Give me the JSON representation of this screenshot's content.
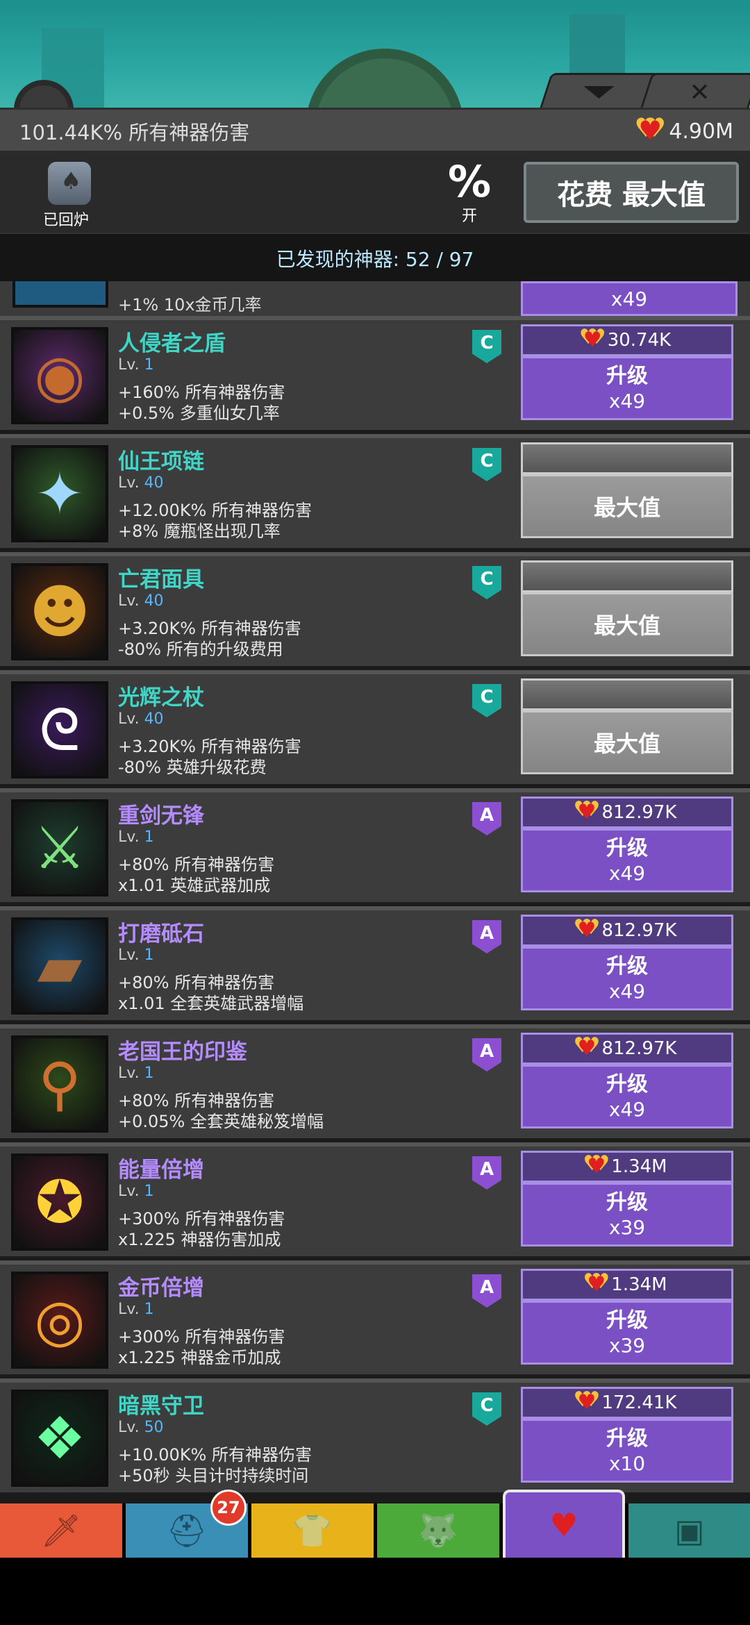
{
  "header": {
    "total_damage": "101.44K% 所有神器伤害",
    "relic_amount": "4.90M"
  },
  "controls": {
    "furnace_label": "已回炉",
    "percent_symbol": "%",
    "percent_state": "开",
    "max_button": "花费 最大值"
  },
  "discovered": "已发现的神器: 52 / 97",
  "partial_row": {
    "effect": "+1% 10x金币几率",
    "button": "x49"
  },
  "artifacts": [
    {
      "name": "人侵者之盾",
      "rarity": "C",
      "level_prefix": "Lv.",
      "level": "1",
      "effect1": "+160% 所有神器伤害",
      "effect2": "+0.5% 多重仙女几率",
      "cost": "30.74K",
      "action": "升级",
      "mult": "x49",
      "maxed": false,
      "icon": "shield-icon",
      "glyph": "◉",
      "glyph_color": "#c46a2e",
      "bg": "#5c2a6a"
    },
    {
      "name": "仙王项链",
      "rarity": "C",
      "level_prefix": "Lv.",
      "level": "40",
      "effect1": "+12.00K% 所有神器伤害",
      "effect2": "+8% 魔瓶怪出现几率",
      "cost": "",
      "action": "最大值",
      "mult": "",
      "maxed": true,
      "icon": "necklace-icon",
      "glyph": "✦",
      "glyph_color": "#9fd8ff",
      "bg": "#2f5a2a"
    },
    {
      "name": "亡君面具",
      "rarity": "C",
      "level_prefix": "Lv.",
      "level": "40",
      "effect1": "+3.20K% 所有神器伤害",
      "effect2": "-80% 所有的升级费用",
      "cost": "",
      "action": "最大值",
      "mult": "",
      "maxed": true,
      "icon": "mask-icon",
      "glyph": "☻",
      "glyph_color": "#e0a830",
      "bg": "#5a2a10"
    },
    {
      "name": "光辉之杖",
      "rarity": "C",
      "level_prefix": "Lv.",
      "level": "40",
      "effect1": "+3.20K% 所有神器伤害",
      "effect2": "-80% 英雄升级花费",
      "cost": "",
      "action": "最大值",
      "mult": "",
      "maxed": true,
      "icon": "staff-icon",
      "glyph": "ᘓ",
      "glyph_color": "#ffffff",
      "bg": "#3a1a5a"
    },
    {
      "name": "重剑无锋",
      "rarity": "A",
      "level_prefix": "Lv.",
      "level": "1",
      "effect1": "+80% 所有神器伤害",
      "effect2": "x1.01 英雄武器加成",
      "cost": "812.97K",
      "action": "升级",
      "mult": "x49",
      "maxed": false,
      "icon": "sword-icon",
      "glyph": "⚔",
      "glyph_color": "#7ee07e",
      "bg": "#1e3e2e"
    },
    {
      "name": "打磨砥石",
      "rarity": "A",
      "level_prefix": "Lv.",
      "level": "1",
      "effect1": "+80% 所有神器伤害",
      "effect2": "x1.01 全套英雄武器增幅",
      "cost": "812.97K",
      "action": "升级",
      "mult": "x49",
      "maxed": false,
      "icon": "whetstone-icon",
      "glyph": "▰",
      "glyph_color": "#a0683a",
      "bg": "#1e4a6a"
    },
    {
      "name": "老国王的印鉴",
      "rarity": "A",
      "level_prefix": "Lv.",
      "level": "1",
      "effect1": "+80% 所有神器伤害",
      "effect2": "+0.05% 全套英雄秘笈增幅",
      "cost": "812.97K",
      "action": "升级",
      "mult": "x49",
      "maxed": false,
      "icon": "seal-icon",
      "glyph": "⚲",
      "glyph_color": "#d07030",
      "bg": "#2e4a1a"
    },
    {
      "name": "能量倍增",
      "rarity": "A",
      "level_prefix": "Lv.",
      "level": "1",
      "effect1": "+300% 所有神器伤害",
      "effect2": "x1.225 神器伤害加成",
      "cost": "1.34M",
      "action": "升级",
      "mult": "x39",
      "maxed": false,
      "icon": "power-orb-icon",
      "glyph": "✪",
      "glyph_color": "#ffd23a",
      "bg": "#4a1a2a"
    },
    {
      "name": "金币倍增",
      "rarity": "A",
      "level_prefix": "Lv.",
      "level": "1",
      "effect1": "+300% 所有神器伤害",
      "effect2": "x1.225 神器金币加成",
      "cost": "1.34M",
      "action": "升级",
      "mult": "x39",
      "maxed": false,
      "icon": "coin-icon",
      "glyph": "◎",
      "glyph_color": "#f0a030",
      "bg": "#5a1a1a"
    },
    {
      "name": "暗黑守卫",
      "rarity": "C",
      "level_prefix": "Lv.",
      "level": "50",
      "effect1": "+10.00K% 所有神器伤害",
      "effect2": "+50秒 头目计时持续时间",
      "cost": "172.41K",
      "action": "升级",
      "mult": "x10",
      "maxed": false,
      "icon": "dark-guard-icon",
      "glyph": "❖",
      "glyph_color": "#6affa0",
      "bg": "#10281a"
    }
  ],
  "nav": {
    "tabs": [
      {
        "name": "sword-tab-icon",
        "glyph": "🗡",
        "color": "#e8593a"
      },
      {
        "name": "hero-tab-icon",
        "glyph": "⛑",
        "color": "#3a8fb7"
      },
      {
        "name": "equipment-tab-icon",
        "glyph": "👕",
        "color": "#e8b21a"
      },
      {
        "name": "pet-tab-icon",
        "glyph": "🐺",
        "color": "#4caa3a"
      },
      {
        "name": "artifact-tab-icon",
        "glyph": "♥",
        "color": "#7a50c4"
      },
      {
        "name": "shop-tab-icon",
        "glyph": "▣",
        "color": "#2f8b86"
      }
    ],
    "hero_badge": "27"
  }
}
